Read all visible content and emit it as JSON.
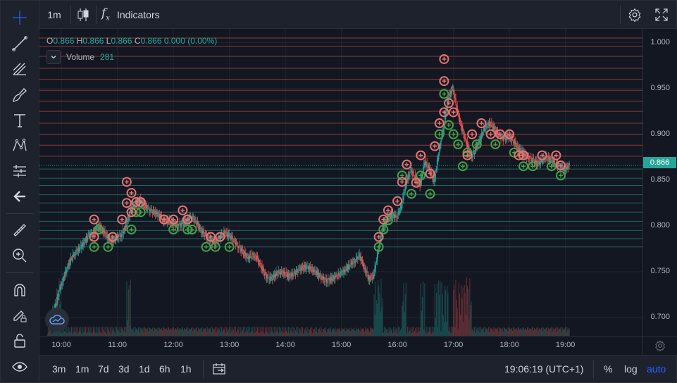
{
  "toolbar": {
    "interval": "1m",
    "indicators": "Indicators"
  },
  "legend": {
    "o_label": "O",
    "o": "0.866",
    "h_label": "H",
    "h": "0.866",
    "l_label": "L",
    "l": "0.866",
    "c_label": "C",
    "c": "0.866",
    "change": "0.000 (0.00%)",
    "volume_label": "Volume",
    "volume": "281"
  },
  "current_price": "0.866",
  "bottom": {
    "ranges": [
      "3m",
      "1m",
      "7d",
      "3d",
      "1d",
      "6h",
      "1h"
    ],
    "time": "19:06:19 (UTC+1)",
    "percent": "%",
    "log": "log",
    "auto": "auto"
  },
  "colors": {
    "up": "#26a69a",
    "down": "#ef5350",
    "accent": "#2962ff",
    "bg": "#131722"
  },
  "chart_data": {
    "type": "candlestick",
    "y_ticks": [
      "1.000",
      "0.950",
      "0.900",
      "0.850",
      "0.800",
      "0.750",
      "0.700"
    ],
    "x_ticks": [
      "10:00",
      "11:00",
      "12:00",
      "13:00",
      "14:00",
      "15:00",
      "16:00",
      "17:00",
      "18:00",
      "19:00"
    ],
    "ylim": [
      0.68,
      1.015
    ],
    "series": [
      {
        "x": "09:45",
        "y": 0.702
      },
      {
        "x": "09:50",
        "y": 0.715
      },
      {
        "x": "09:55",
        "y": 0.735
      },
      {
        "x": "10:00",
        "y": 0.748
      },
      {
        "x": "10:05",
        "y": 0.762
      },
      {
        "x": "10:10",
        "y": 0.77
      },
      {
        "x": "10:15",
        "y": 0.775
      },
      {
        "x": "10:20",
        "y": 0.782
      },
      {
        "x": "10:25",
        "y": 0.79
      },
      {
        "x": "10:30",
        "y": 0.792
      },
      {
        "x": "10:35",
        "y": 0.8
      },
      {
        "x": "10:40",
        "y": 0.795
      },
      {
        "x": "10:45",
        "y": 0.788
      },
      {
        "x": "10:50",
        "y": 0.783
      },
      {
        "x": "10:55",
        "y": 0.787
      },
      {
        "x": "11:00",
        "y": 0.79
      },
      {
        "x": "11:05",
        "y": 0.8
      },
      {
        "x": "11:10",
        "y": 0.818
      },
      {
        "x": "11:15",
        "y": 0.825
      },
      {
        "x": "11:20",
        "y": 0.828
      },
      {
        "x": "11:25",
        "y": 0.822
      },
      {
        "x": "11:30",
        "y": 0.818
      },
      {
        "x": "11:35",
        "y": 0.815
      },
      {
        "x": "11:40",
        "y": 0.812
      },
      {
        "x": "11:45",
        "y": 0.806
      },
      {
        "x": "11:50",
        "y": 0.805
      },
      {
        "x": "11:55",
        "y": 0.803
      },
      {
        "x": "12:00",
        "y": 0.8
      },
      {
        "x": "12:05",
        "y": 0.802
      },
      {
        "x": "12:10",
        "y": 0.806
      },
      {
        "x": "12:15",
        "y": 0.81
      },
      {
        "x": "12:20",
        "y": 0.805
      },
      {
        "x": "12:25",
        "y": 0.795
      },
      {
        "x": "12:30",
        "y": 0.79
      },
      {
        "x": "12:35",
        "y": 0.785
      },
      {
        "x": "12:40",
        "y": 0.782
      },
      {
        "x": "12:45",
        "y": 0.787
      },
      {
        "x": "12:50",
        "y": 0.792
      },
      {
        "x": "12:55",
        "y": 0.79
      },
      {
        "x": "13:00",
        "y": 0.785
      },
      {
        "x": "13:05",
        "y": 0.778
      },
      {
        "x": "13:10",
        "y": 0.772
      },
      {
        "x": "13:15",
        "y": 0.765
      },
      {
        "x": "13:20",
        "y": 0.768
      },
      {
        "x": "13:25",
        "y": 0.765
      },
      {
        "x": "13:30",
        "y": 0.755
      },
      {
        "x": "13:35",
        "y": 0.745
      },
      {
        "x": "13:40",
        "y": 0.742
      },
      {
        "x": "13:45",
        "y": 0.747
      },
      {
        "x": "13:50",
        "y": 0.75
      },
      {
        "x": "13:55",
        "y": 0.748
      },
      {
        "x": "14:00",
        "y": 0.745
      },
      {
        "x": "14:05",
        "y": 0.748
      },
      {
        "x": "14:10",
        "y": 0.752
      },
      {
        "x": "14:15",
        "y": 0.755
      },
      {
        "x": "14:20",
        "y": 0.755
      },
      {
        "x": "14:25",
        "y": 0.752
      },
      {
        "x": "14:30",
        "y": 0.748
      },
      {
        "x": "14:35",
        "y": 0.743
      },
      {
        "x": "14:40",
        "y": 0.74
      },
      {
        "x": "14:45",
        "y": 0.742
      },
      {
        "x": "14:50",
        "y": 0.745
      },
      {
        "x": "14:55",
        "y": 0.748
      },
      {
        "x": "15:00",
        "y": 0.752
      },
      {
        "x": "15:05",
        "y": 0.758
      },
      {
        "x": "15:10",
        "y": 0.762
      },
      {
        "x": "15:15",
        "y": 0.768
      },
      {
        "x": "15:20",
        "y": 0.755
      },
      {
        "x": "15:25",
        "y": 0.742
      },
      {
        "x": "15:30",
        "y": 0.745
      },
      {
        "x": "15:35",
        "y": 0.772
      },
      {
        "x": "15:40",
        "y": 0.798
      },
      {
        "x": "15:45",
        "y": 0.808
      },
      {
        "x": "15:50",
        "y": 0.812
      },
      {
        "x": "15:55",
        "y": 0.81
      },
      {
        "x": "16:00",
        "y": 0.822
      },
      {
        "x": "16:05",
        "y": 0.848
      },
      {
        "x": "16:10",
        "y": 0.86
      },
      {
        "x": "16:15",
        "y": 0.852
      },
      {
        "x": "16:20",
        "y": 0.845
      },
      {
        "x": "16:25",
        "y": 0.87
      },
      {
        "x": "16:30",
        "y": 0.862
      },
      {
        "x": "16:35",
        "y": 0.848
      },
      {
        "x": "16:40",
        "y": 0.88
      },
      {
        "x": "16:45",
        "y": 0.908
      },
      {
        "x": "16:50",
        "y": 0.94
      },
      {
        "x": "16:55",
        "y": 0.95
      },
      {
        "x": "17:00",
        "y": 0.925
      },
      {
        "x": "17:05",
        "y": 0.905
      },
      {
        "x": "17:10",
        "y": 0.89
      },
      {
        "x": "17:15",
        "y": 0.875
      },
      {
        "x": "17:20",
        "y": 0.885
      },
      {
        "x": "17:25",
        "y": 0.897
      },
      {
        "x": "17:30",
        "y": 0.908
      },
      {
        "x": "17:35",
        "y": 0.912
      },
      {
        "x": "17:40",
        "y": 0.905
      },
      {
        "x": "17:45",
        "y": 0.898
      },
      {
        "x": "17:50",
        "y": 0.895
      },
      {
        "x": "17:55",
        "y": 0.898
      },
      {
        "x": "18:00",
        "y": 0.893
      },
      {
        "x": "18:05",
        "y": 0.885
      },
      {
        "x": "18:10",
        "y": 0.88
      },
      {
        "x": "18:15",
        "y": 0.875
      },
      {
        "x": "18:20",
        "y": 0.872
      },
      {
        "x": "18:25",
        "y": 0.868
      },
      {
        "x": "18:30",
        "y": 0.87
      },
      {
        "x": "18:35",
        "y": 0.875
      },
      {
        "x": "18:40",
        "y": 0.872
      },
      {
        "x": "18:45",
        "y": 0.868
      },
      {
        "x": "18:50",
        "y": 0.865
      },
      {
        "x": "18:55",
        "y": 0.862
      },
      {
        "x": "19:00",
        "y": 0.866
      }
    ],
    "sell_levels": [
      1.005,
      0.996,
      0.985,
      0.972,
      0.96,
      0.948,
      0.936,
      0.925,
      0.912,
      0.9,
      0.888,
      0.876
    ],
    "buy_levels": [
      0.862,
      0.852,
      0.844,
      0.834,
      0.825,
      0.815,
      0.805,
      0.795,
      0.786,
      0.777
    ],
    "sell_markers": [
      {
        "x": "10:35",
        "y": 0.807
      },
      {
        "x": "10:35",
        "y": 0.788
      },
      {
        "x": "10:55",
        "y": 0.788
      },
      {
        "x": "11:05",
        "y": 0.807
      },
      {
        "x": "11:10",
        "y": 0.848
      },
      {
        "x": "11:10",
        "y": 0.825
      },
      {
        "x": "11:15",
        "y": 0.836
      },
      {
        "x": "11:15",
        "y": 0.815
      },
      {
        "x": "11:20",
        "y": 0.826
      },
      {
        "x": "11:25",
        "y": 0.826
      },
      {
        "x": "11:50",
        "y": 0.807
      },
      {
        "x": "12:00",
        "y": 0.807
      },
      {
        "x": "12:10",
        "y": 0.817
      },
      {
        "x": "12:15",
        "y": 0.807
      },
      {
        "x": "12:40",
        "y": 0.788
      },
      {
        "x": "12:50",
        "y": 0.788
      },
      {
        "x": "15:40",
        "y": 0.788
      },
      {
        "x": "15:45",
        "y": 0.807
      },
      {
        "x": "15:50",
        "y": 0.817
      },
      {
        "x": "16:00",
        "y": 0.827
      },
      {
        "x": "16:05",
        "y": 0.848
      },
      {
        "x": "16:10",
        "y": 0.867
      },
      {
        "x": "16:20",
        "y": 0.847
      },
      {
        "x": "16:25",
        "y": 0.877
      },
      {
        "x": "16:35",
        "y": 0.857
      },
      {
        "x": "16:40",
        "y": 0.887
      },
      {
        "x": "16:45",
        "y": 0.912
      },
      {
        "x": "16:50",
        "y": 0.924
      },
      {
        "x": "16:50",
        "y": 0.958
      },
      {
        "x": "16:50",
        "y": 0.982
      },
      {
        "x": "16:55",
        "y": 0.934
      },
      {
        "x": "17:00",
        "y": 0.924
      },
      {
        "x": "17:15",
        "y": 0.877
      },
      {
        "x": "17:20",
        "y": 0.9
      },
      {
        "x": "17:30",
        "y": 0.912
      },
      {
        "x": "17:40",
        "y": 0.9
      },
      {
        "x": "17:50",
        "y": 0.9
      },
      {
        "x": "18:00",
        "y": 0.9
      },
      {
        "x": "18:10",
        "y": 0.877
      },
      {
        "x": "18:15",
        "y": 0.877
      },
      {
        "x": "18:35",
        "y": 0.877
      },
      {
        "x": "18:50",
        "y": 0.877
      },
      {
        "x": "18:55",
        "y": 0.866
      }
    ],
    "buy_markers": [
      {
        "x": "10:35",
        "y": 0.777
      },
      {
        "x": "10:40",
        "y": 0.796
      },
      {
        "x": "10:50",
        "y": 0.777
      },
      {
        "x": "11:15",
        "y": 0.796
      },
      {
        "x": "11:20",
        "y": 0.815
      },
      {
        "x": "11:25",
        "y": 0.815
      },
      {
        "x": "12:00",
        "y": 0.796
      },
      {
        "x": "12:15",
        "y": 0.796
      },
      {
        "x": "12:20",
        "y": 0.796
      },
      {
        "x": "12:35",
        "y": 0.777
      },
      {
        "x": "12:45",
        "y": 0.777
      },
      {
        "x": "13:00",
        "y": 0.777
      },
      {
        "x": "15:40",
        "y": 0.777
      },
      {
        "x": "15:45",
        "y": 0.796
      },
      {
        "x": "15:50",
        "y": 0.806
      },
      {
        "x": "16:05",
        "y": 0.855
      },
      {
        "x": "16:15",
        "y": 0.835
      },
      {
        "x": "16:25",
        "y": 0.855
      },
      {
        "x": "16:35",
        "y": 0.835
      },
      {
        "x": "16:45",
        "y": 0.9
      },
      {
        "x": "16:50",
        "y": 0.944
      },
      {
        "x": "16:55",
        "y": 0.91
      },
      {
        "x": "17:00",
        "y": 0.9
      },
      {
        "x": "17:05",
        "y": 0.889
      },
      {
        "x": "17:10",
        "y": 0.865
      },
      {
        "x": "17:15",
        "y": 0.88
      },
      {
        "x": "17:25",
        "y": 0.889
      },
      {
        "x": "17:45",
        "y": 0.889
      },
      {
        "x": "18:05",
        "y": 0.88
      },
      {
        "x": "18:15",
        "y": 0.865
      },
      {
        "x": "18:25",
        "y": 0.865
      },
      {
        "x": "18:45",
        "y": 0.865
      },
      {
        "x": "18:55",
        "y": 0.855
      }
    ]
  }
}
